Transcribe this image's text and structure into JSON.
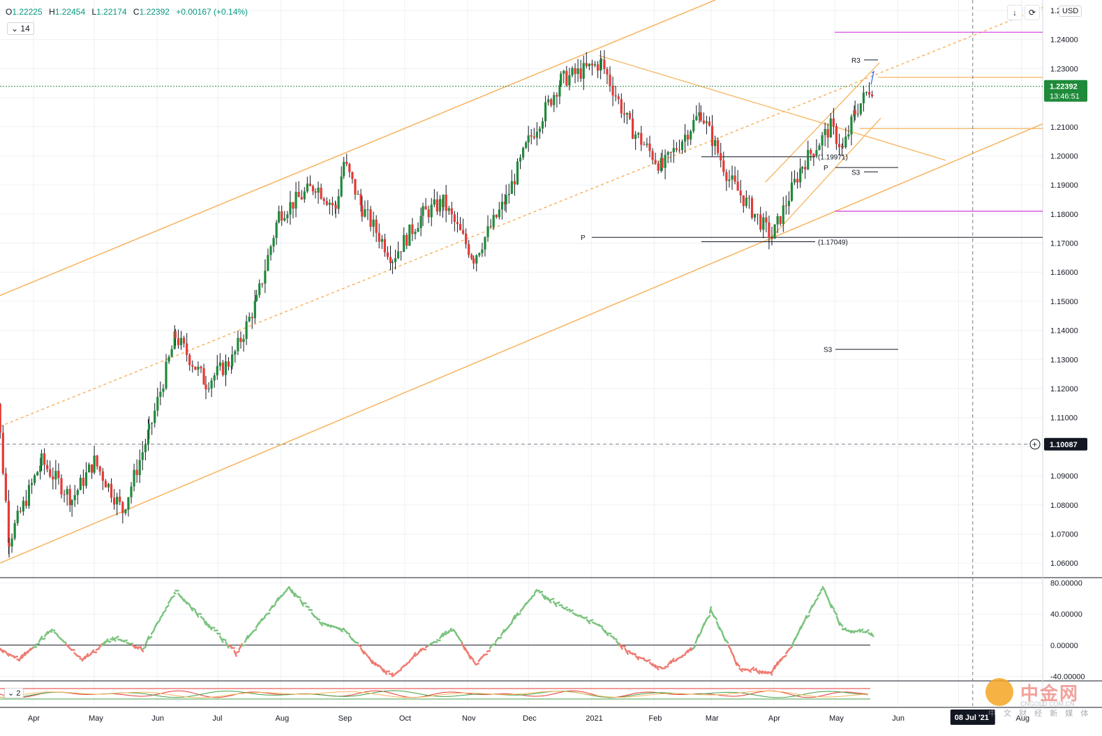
{
  "toolbar": {
    "ohlc": {
      "open_label": "O",
      "open": "1.22225",
      "high_label": "H",
      "high": "1.22454",
      "low_label": "L",
      "low": "1.22174",
      "close_label": "C",
      "close": "1.22392",
      "change": "+0.00167 (+0.14%)"
    },
    "indicator_length": "14",
    "oscillator_param": "2",
    "currency": "USD",
    "icons": [
      "arrow-down-icon",
      "fullscreen-icon"
    ]
  },
  "watermark": {
    "title": "中金网",
    "url": "CNGOLD.COM.CN",
    "subtitle": "中 文 财 经 新 媒 体"
  },
  "chart_data": [
    {
      "type": "candlestick",
      "series_name": "",
      "y_range": [
        1.055,
        1.2536
      ],
      "y_ticks": [
        1.06,
        1.07,
        1.08,
        1.09,
        1.1,
        1.11,
        1.12,
        1.13,
        1.14,
        1.15,
        1.16,
        1.17,
        1.18,
        1.19,
        1.2,
        1.21,
        1.22,
        1.23,
        1.24,
        1.25
      ],
      "y_tick_labels": [
        "1.06000",
        "1.07000",
        "1.08000",
        "1.09000",
        "1.10000",
        "1.11000",
        "1.12000",
        "1.13000",
        "1.14000",
        "1.15000",
        "1.16000",
        "1.17000",
        "1.18000",
        "1.19000",
        "1.20000",
        "1.21000",
        "1.22000",
        "1.23000",
        "1.24000",
        "1.2"
      ],
      "x_labels": [
        "Apr",
        "May",
        "Jun",
        "Jul",
        "Aug",
        "Sep",
        "Oct",
        "Nov",
        "Dec",
        "2021",
        "Feb",
        "Mar",
        "Apr",
        "May",
        "Jun",
        "Jul",
        "Aug"
      ],
      "crosshair_date": "08 Jul '21",
      "grid": true,
      "last_price": "1.22392",
      "countdown": "13:46:51",
      "crosshair_price": "1.10087",
      "colors": {
        "up": "#1f8a3a",
        "down": "#e53935",
        "trend": "#f7b35c",
        "pivot": "#d84de0",
        "last_price": "#1f8a3a"
      },
      "anchor_points": [
        [
          "2020-03-10",
          1.1495
        ],
        [
          "2020-03-20",
          1.068
        ],
        [
          "2020-04-05",
          1.095
        ],
        [
          "2020-04-20",
          1.082
        ],
        [
          "2020-05-01",
          1.095
        ],
        [
          "2020-05-15",
          1.078
        ],
        [
          "2020-05-28",
          1.105
        ],
        [
          "2020-06-10",
          1.138
        ],
        [
          "2020-06-25",
          1.122
        ],
        [
          "2020-07-08",
          1.13
        ],
        [
          "2020-07-20",
          1.15
        ],
        [
          "2020-07-31",
          1.18
        ],
        [
          "2020-08-18",
          1.19
        ],
        [
          "2020-08-28",
          1.182
        ],
        [
          "2020-09-01",
          1.198
        ],
        [
          "2020-09-10",
          1.182
        ],
        [
          "2020-09-25",
          1.165
        ],
        [
          "2020-10-10",
          1.18
        ],
        [
          "2020-10-20",
          1.184
        ],
        [
          "2020-11-04",
          1.165
        ],
        [
          "2020-11-20",
          1.185
        ],
        [
          "2020-12-01",
          1.205
        ],
        [
          "2020-12-17",
          1.226
        ],
        [
          "2021-01-06",
          1.232
        ],
        [
          "2021-01-20",
          1.21
        ],
        [
          "2021-02-05",
          1.196
        ],
        [
          "2021-02-24",
          1.215
        ],
        [
          "2021-03-10",
          1.192
        ],
        [
          "2021-03-31",
          1.172
        ],
        [
          "2021-04-15",
          1.197
        ],
        [
          "2021-04-29",
          1.21
        ],
        [
          "2021-05-05",
          1.202
        ],
        [
          "2021-05-11",
          1.215
        ],
        [
          "2021-05-18",
          1.223
        ],
        [
          "2021-05-25",
          1.225
        ]
      ],
      "annotations": [
        {
          "label": "R3",
          "y": 1.233
        },
        {
          "label": "P",
          "y": 1.172
        },
        {
          "label": "(1.17049)",
          "y": 1.1705
        },
        {
          "label": "(1.19971)",
          "y": 1.1997
        },
        {
          "label": "P",
          "y": 1.196
        },
        {
          "label": "S3",
          "y": 1.1945
        },
        {
          "label": "S3",
          "y": 1.1335
        }
      ]
    },
    {
      "type": "line",
      "series_name": "",
      "y_range": [
        -45,
        85
      ],
      "y_ticks": [
        80,
        40,
        0,
        -40
      ],
      "y_tick_labels": [
        "80.00000",
        "40.00000",
        "0.00000",
        "-40.00000"
      ],
      "colors": {
        "positive": "#7bc47f",
        "negative": "#ef7b72",
        "zero": "#131722"
      },
      "anchor_points": [
        [
          "2020-03-10",
          5
        ],
        [
          "2020-03-25",
          -20
        ],
        [
          "2020-04-10",
          20
        ],
        [
          "2020-04-25",
          -20
        ],
        [
          "2020-05-10",
          10
        ],
        [
          "2020-05-25",
          -5
        ],
        [
          "2020-06-10",
          70
        ],
        [
          "2020-06-25",
          30
        ],
        [
          "2020-07-10",
          -10
        ],
        [
          "2020-07-25",
          40
        ],
        [
          "2020-08-05",
          75
        ],
        [
          "2020-08-20",
          30
        ],
        [
          "2020-09-01",
          20
        ],
        [
          "2020-09-15",
          -20
        ],
        [
          "2020-09-25",
          -40
        ],
        [
          "2020-10-10",
          -5
        ],
        [
          "2020-10-25",
          20
        ],
        [
          "2020-11-05",
          -25
        ],
        [
          "2020-11-20",
          20
        ],
        [
          "2020-12-05",
          70
        ],
        [
          "2020-12-20",
          45
        ],
        [
          "2021-01-05",
          25
        ],
        [
          "2021-01-20",
          -10
        ],
        [
          "2021-02-05",
          -30
        ],
        [
          "2021-02-20",
          -5
        ],
        [
          "2021-03-01",
          45
        ],
        [
          "2021-03-15",
          -30
        ],
        [
          "2021-03-31",
          -35
        ],
        [
          "2021-04-10",
          0
        ],
        [
          "2021-04-25",
          75
        ],
        [
          "2021-05-05",
          20
        ],
        [
          "2021-05-20",
          15
        ]
      ]
    },
    {
      "type": "line",
      "series_name": "",
      "colors": {
        "line1": "#e53935",
        "line2": "#43a047",
        "line3": "#f7b35c"
      }
    }
  ]
}
